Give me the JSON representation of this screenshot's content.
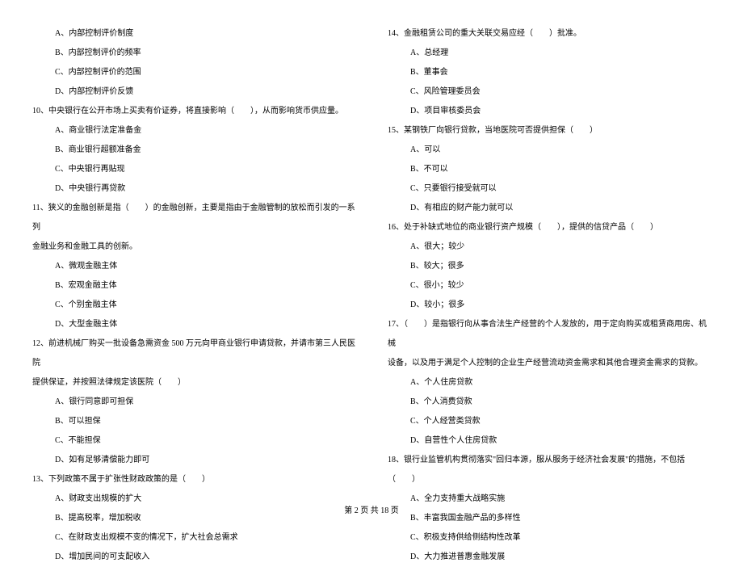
{
  "left": {
    "q9_options": [
      "A、内部控制评价制度",
      "B、内部控制评价的频率",
      "C、内部控制评价的范围",
      "D、内部控制评价反馈"
    ],
    "q10": "10、中央银行在公开市场上买卖有价证券，将直接影响（　　），从而影响货币供应量。",
    "q10_options": [
      "A、商业银行法定准备金",
      "B、商业银行超额准备金",
      "C、中央银行再贴现",
      "D、中央银行再贷款"
    ],
    "q11": "11、狭义的金融创新是指（　　）的金融创新，主要是指由于金融管制的放松而引发的一系列",
    "q11_cont": "金融业务和金融工具的创新。",
    "q11_options": [
      "A、微观金融主体",
      "B、宏观金融主体",
      "C、个别金融主体",
      "D、大型金融主体"
    ],
    "q12": "12、前进机械厂购买一批设备急需资金 500 万元向甲商业银行申请贷款，并请市第三人民医院",
    "q12_cont": "提供保证，并按照法律规定该医院（　　）",
    "q12_options": [
      "A、银行同意即可担保",
      "B、可以担保",
      "C、不能担保",
      "D、如有足够清偿能力即可"
    ],
    "q13": "13、下列政策不属于扩张性财政政策的是（　　）",
    "q13_options": [
      "A、财政支出规模的扩大",
      "B、提高税率，增加税收",
      "C、在财政支出规模不变的情况下，扩大社会总需求",
      "D、增加民间的可支配收入"
    ]
  },
  "right": {
    "q14": "14、金融租赁公司的重大关联交易应经（　　）批准。",
    "q14_options": [
      "A、总经理",
      "B、董事会",
      "C、风险管理委员会",
      "D、项目审核委员会"
    ],
    "q15": "15、某钢铁厂向银行贷款，当地医院可否提供担保（　　）",
    "q15_options": [
      "A、可以",
      "B、不可以",
      "C、只要银行接受就可以",
      "D、有相应的财产能力就可以"
    ],
    "q16": "16、处于补缺式地位的商业银行资产规模（　　），提供的信贷产品（　　）",
    "q16_options": [
      "A、很大；较少",
      "B、较大；很多",
      "C、很小；较少",
      "D、较小；很多"
    ],
    "q17": "17、（　　）是指银行向从事合法生产经营的个人发放的，用于定向购买或租赁商用房、机械",
    "q17_cont": "设备，以及用于满足个人控制的企业生产经营流动资金需求和其他合理资金需求的贷款。",
    "q17_options": [
      "A、个人住房贷款",
      "B、个人消费贷款",
      "C、个人经营类贷款",
      "D、自营性个人住房贷款"
    ],
    "q18": "18、银行业监管机构贯彻落实\"回归本源，服从服务于经济社会发展\"的措施，不包括（　　）",
    "q18_options": [
      "A、全力支持重大战略实施",
      "B、丰富我国金融产品的多样性",
      "C、积极支持供给侧结构性改革",
      "D、大力推进普惠金融发展"
    ]
  },
  "footer": "第 2 页 共 18 页"
}
